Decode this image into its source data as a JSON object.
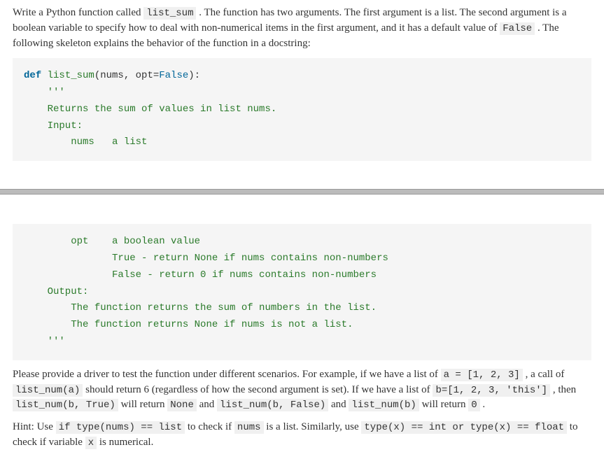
{
  "intro": {
    "p1_a": "Write a Python function called ",
    "p1_code1": "list_sum",
    "p1_b": " . The function has two arguments. The first argument is a list. The second argument is a boolean variable to specify how to deal with non-numerical items in the first argument, and it has a default value of ",
    "p1_code2": "False",
    "p1_c": " . The following skeleton explains the behavior of the function in a docstring:"
  },
  "code1": {
    "def_kw": "def ",
    "fn": "list_sum",
    "sig_a": "(nums, opt=",
    "false_kw": "False",
    "sig_b": "):",
    "q1": "    '''",
    "l1": "    Returns the sum of values in list nums.",
    "l2": "    Input:",
    "l3": "        nums   a list"
  },
  "code2": {
    "l1": "        opt    a boolean value",
    "l2": "               True - return None if nums contains non-numbers",
    "l3": "               False - return 0 if nums contains non-numbers",
    "l4": "    Output:",
    "l5": "        The function returns the sum of numbers in the list.",
    "l6": "        The function returns None if nums is not a list.",
    "q2": "    '''"
  },
  "outro": {
    "p2_a": "Please provide a driver to test the function under different scenarios. For example, if we have a list of ",
    "p2_code1": "a = [1, 2, 3]",
    "p2_b": " , a call of ",
    "p2_code2": "list_num(a)",
    "p2_c": " should return 6 (regardless of how the second argument is set). If we have a list of ",
    "p2_code3": "b=[1, 2, 3, 'this']",
    "p2_d": " , then ",
    "p2_code4": "list_num(b, True)",
    "p2_e": " will return ",
    "p2_code5": "None",
    "p2_f": " and ",
    "p2_code6": "list_num(b, False)",
    "p2_g": " and ",
    "p2_code7": "list_num(b)",
    "p2_h": " will return ",
    "p2_code8": "0",
    "p2_i": " ."
  },
  "hint": {
    "a": "Hint: Use ",
    "c1": "if type(nums) == list",
    "b": " to check if ",
    "c2": "nums",
    "c": " is a list. Similarly, use ",
    "c3": "type(x) == int or type(x) == float",
    "d": " to check if variable ",
    "c4": "x",
    "e": " is numerical."
  }
}
